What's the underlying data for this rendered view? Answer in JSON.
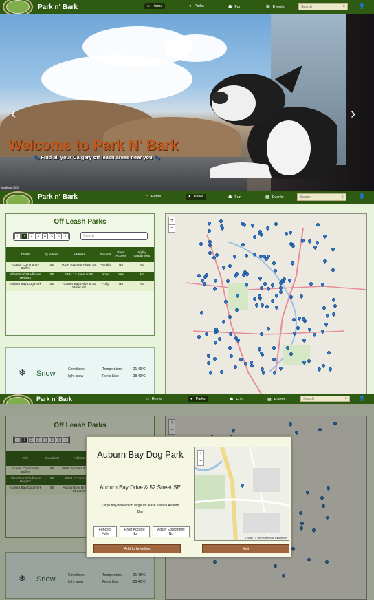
{
  "nav": {
    "brand": "Park n' Bark",
    "items": [
      {
        "label": "Home",
        "icon": "home-icon"
      },
      {
        "label": "Parks",
        "icon": "pin-icon"
      },
      {
        "label": "Fun",
        "icon": "running-icon"
      },
      {
        "label": "Events",
        "icon": "calendar-icon"
      }
    ],
    "search_placeholder": "Search"
  },
  "hero": {
    "title": "Welcome to Park N' Bark",
    "subtitle": "Find all your Calgary off leash areas near you",
    "credit": "localhost:3000"
  },
  "parks": {
    "title": "Off Leash Parks",
    "pages": [
      "1",
      "2",
      "3",
      "4",
      "5",
      "6"
    ],
    "search_placeholder": "Search",
    "columns": [
      "Title",
      "Quadrant",
      "Address",
      "Fenced",
      "River Access",
      "Agility Equipment"
    ],
    "rows": [
      {
        "title": "Acadia Community Buffer",
        "quadrant": "SE",
        "address": "900R Avonlea Place SE",
        "fenced": "Partially",
        "river": "No",
        "agility": "No"
      },
      {
        "title": "Albert Park/Radisson Heights",
        "quadrant": "SE",
        "address": "2204 17 Avenue SE",
        "fenced": "None",
        "river": "Yes",
        "agility": "No"
      },
      {
        "title": "Auburn Bay Dog Park",
        "quadrant": "SE",
        "address": "Auburn Bay Drive & 52 Street SE",
        "fenced": "Fully",
        "river": "No",
        "agility": "No"
      }
    ]
  },
  "weather": {
    "icon": "snowflake-icon",
    "label": "Snow",
    "conditions_label": "Conditions:",
    "conditions_value": "light snow",
    "temperature_label": "Temperature:",
    "temperature_value": "-21.43°C",
    "feels_label": "Feels Like:",
    "feels_value": "-28.43°C"
  },
  "modal": {
    "title": "Auburn Bay Dog Park",
    "address": "Auburn Bay Drive & 52 Street SE",
    "description": "Large fully fenced off large off lease area in Auburn Bay",
    "fenced_label": "Fenced:",
    "fenced_value": "Fully",
    "river_label": "River Access:",
    "river_value": "No",
    "agility_label": "Agility Equipment:",
    "agility_value": "No",
    "add_button": "Add to favorites",
    "exit_button": "Exit",
    "map_attribution": "Leaflet | © OpenStreetMap contributors"
  },
  "colors": {
    "nav": "#2f5a12",
    "accent": "#c0571c",
    "pin": "#2c7bd6",
    "button": "#a0673f"
  }
}
